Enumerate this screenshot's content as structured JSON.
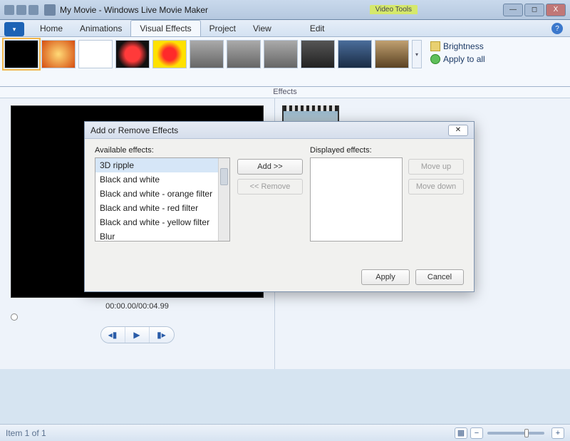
{
  "window": {
    "title": "My Movie - Windows Live Movie Maker",
    "video_tools_label": "Video Tools",
    "min": "—",
    "max": "◻",
    "close": "X"
  },
  "tabs": {
    "home": "Home",
    "animations": "Animations",
    "visual_effects": "Visual Effects",
    "project": "Project",
    "view": "View",
    "edit": "Edit"
  },
  "ribbon": {
    "brightness": "Brightness",
    "apply_all": "Apply to all",
    "caption": "Effects",
    "dropdown_glyph": "▾"
  },
  "preview": {
    "timecode": "00:00.00/00:04.99",
    "prev": "◂▮",
    "play": "▶",
    "next": "▮▸"
  },
  "dialog": {
    "title": "Add or Remove Effects",
    "close": "✕",
    "available_label": "Available effects:",
    "displayed_label": "Displayed effects:",
    "items": {
      "i0": "3D ripple",
      "i1": "Black and white",
      "i2": "Black and white - orange filter",
      "i3": "Black and white - red filter",
      "i4": "Black and white - yellow filter",
      "i5": "Blur"
    },
    "add": "Add >>",
    "remove": "<< Remove",
    "move_up": "Move up",
    "move_down": "Move down",
    "apply": "Apply",
    "cancel": "Cancel"
  },
  "status": {
    "text": "Item 1 of 1",
    "zoom_out": "−",
    "zoom_in": "+"
  },
  "help": "?"
}
